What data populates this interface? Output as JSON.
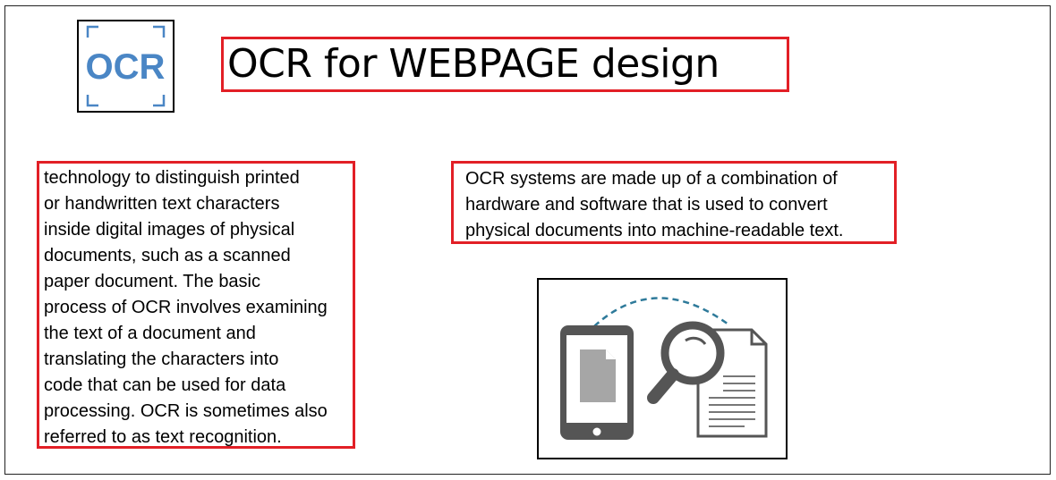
{
  "logo": {
    "text": "OCR",
    "color": "#4a86c5"
  },
  "title": "OCR for WEBPAGE design",
  "left_paragraph": "technology to distinguish printed\nor handwritten text characters\ninside digital images of physical\ndocuments, such as a scanned\npaper document. The basic\nprocess of OCR involves examining\nthe text of a document and\ntranslating the characters into\ncode that can be used for data\nprocessing. OCR is sometimes also\nreferred to as text recognition.",
  "right_paragraph": "OCR systems are made up of a combination of\nhardware and software that is used to convert\nphysical documents into machine-readable text.",
  "colors": {
    "highlight_border": "#e21f26",
    "icon_dark": "#555555",
    "icon_mid": "#a6a6a6",
    "arc": "#2e7a9a"
  },
  "illustration": {
    "icons": [
      "tablet-icon",
      "document-icon",
      "magnifier-icon"
    ]
  }
}
